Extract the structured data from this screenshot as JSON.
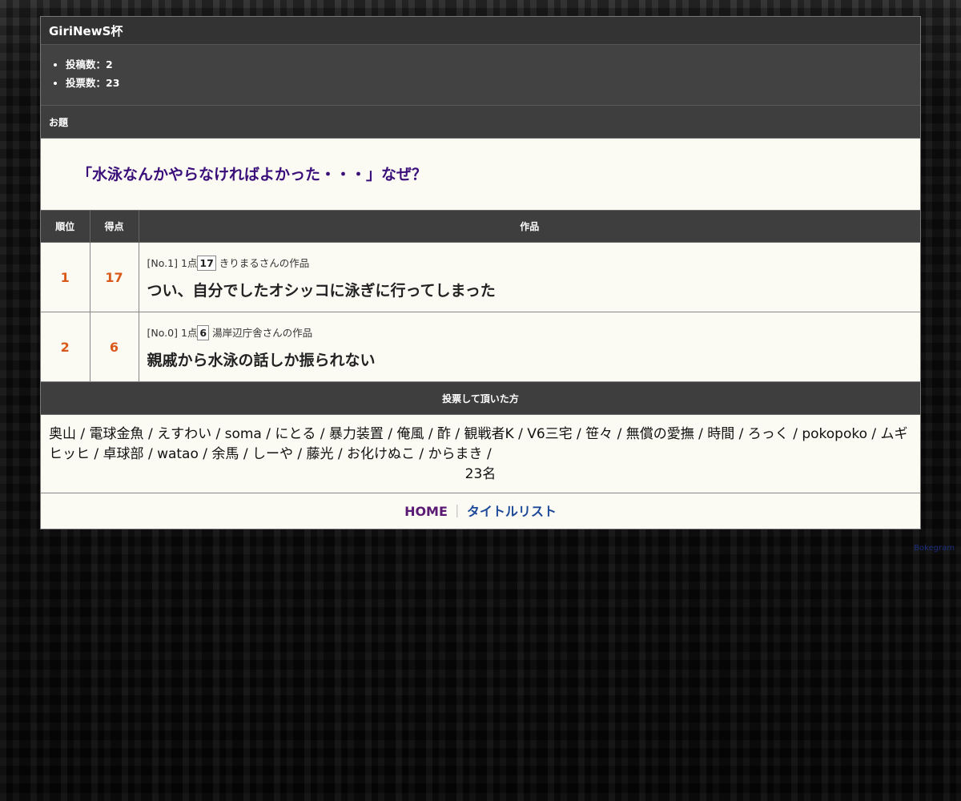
{
  "cup": {
    "title": "GiriNewS杯"
  },
  "stats": {
    "posts": "投稿数：2",
    "votes": "投票数：23"
  },
  "odai": {
    "heading": "お題",
    "text": "「水泳なんかやらなければよかった・・・」なぜ？"
  },
  "ranking": {
    "headers": {
      "rank": "順位",
      "score": "得点",
      "work": "作品"
    },
    "rows": [
      {
        "rank": "1",
        "score": "17",
        "no": "[No.1]",
        "points_label": "1点",
        "points_box": "17",
        "author": "きりまるさんの作品",
        "answer": "つい、自分でしたオシッコに泳ぎに行ってしまった"
      },
      {
        "rank": "2",
        "score": "6",
        "no": "[No.0]",
        "points_label": "1点",
        "points_box": "6",
        "author": "湯岸辺庁舎さんの作品",
        "answer": "親戚から水泳の話しか振られない"
      }
    ]
  },
  "voters": {
    "heading": "投票して頂いた方",
    "names": "奥山 / 電球金魚 / えすわい / soma / にとる / 暴力装置 / 俺風 / 酢 / 観戦者K / V6三宅 / 笹々 / 無償の愛撫 / 時間 / ろっく / pokopoko / ムギヒッヒ / 卓球部 / watao / 余馬 / しーや / 藤光 / お化けぬこ / からまき /",
    "count": "23名"
  },
  "nav": {
    "home": "HOME",
    "separator": "｜",
    "title_list": "タイトルリスト"
  },
  "footer": {
    "brand": "Bokegram"
  }
}
